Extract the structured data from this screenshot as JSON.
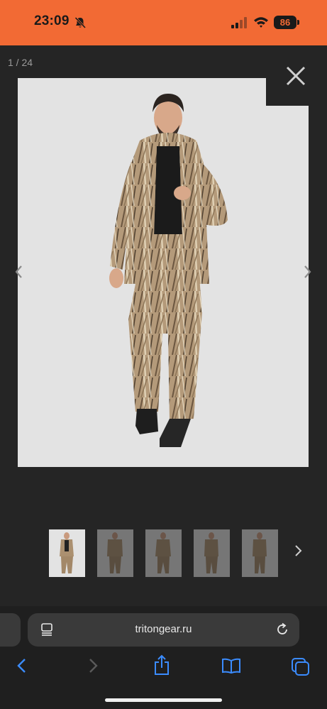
{
  "status_bar": {
    "time": "23:09",
    "battery": "86",
    "background_color": "#f26a34"
  },
  "gallery": {
    "counter": "1 / 24",
    "close_icon": "close-icon",
    "prev_icon": "chevron-left-icon",
    "next_icon": "chevron-right-icon",
    "main_image_alt": "man-in-reed-camouflage-suit-photo",
    "thumbnails": [
      {
        "selected": true
      },
      {
        "selected": false
      },
      {
        "selected": false
      },
      {
        "selected": false
      },
      {
        "selected": false
      }
    ]
  },
  "browser": {
    "url": "tritongear.ru",
    "toolbar": [
      "back-icon",
      "forward-icon",
      "share-icon",
      "bookmarks-icon",
      "tabs-icon"
    ],
    "accent_color": "#3b8cff"
  }
}
